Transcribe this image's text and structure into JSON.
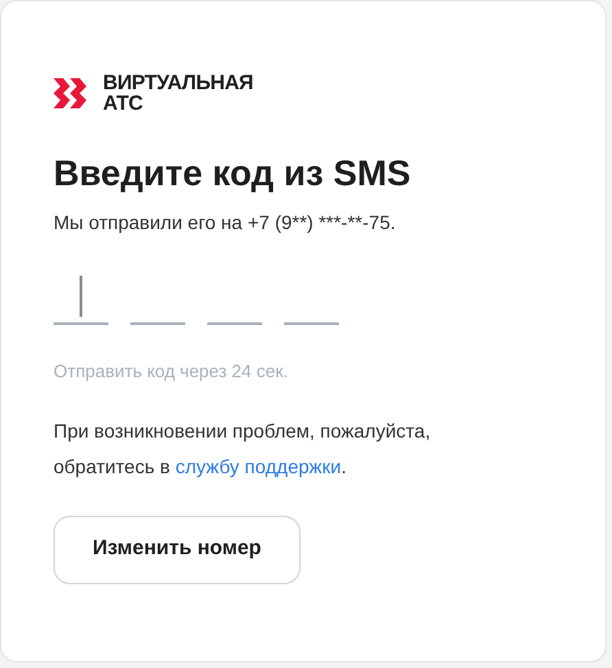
{
  "logo": {
    "line_1": "ВИРТУАЛЬНАЯ",
    "line_2": "АТС"
  },
  "title": "Введите код из SMS",
  "subtitle": "Мы отправили его на +7 (9**) ***-**-75.",
  "code_slots": [
    {
      "focused": true
    },
    {
      "focused": false
    },
    {
      "focused": false
    },
    {
      "focused": false
    }
  ],
  "resend_note": "Отправить код через 24 сек.",
  "help": {
    "text_before": "При возникновении проблем, пожалуйста, обратитесь в",
    "link": "службу поддержки",
    "text_after": "."
  },
  "change_number_button": "Изменить номер"
}
